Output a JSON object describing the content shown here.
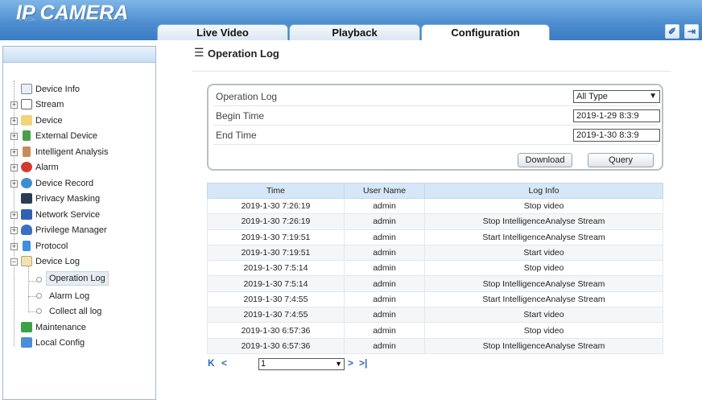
{
  "app": {
    "logo": "IP CAMERA"
  },
  "tabs": [
    {
      "label": "Live Video"
    },
    {
      "label": "Playback"
    },
    {
      "label": "Configuration",
      "active": true
    }
  ],
  "header_icons": [
    {
      "icon": "edit-icon"
    },
    {
      "icon": "logout-icon"
    }
  ],
  "sidebar": {
    "items": [
      {
        "label": "Device Info",
        "icon": "device-info-icon"
      },
      {
        "label": "Stream",
        "icon": "stream-icon"
      },
      {
        "label": "Device",
        "icon": "device-icon"
      },
      {
        "label": "External Device",
        "icon": "external-device-icon"
      },
      {
        "label": "Intelligent Analysis",
        "icon": "intelligent-analysis-icon"
      },
      {
        "label": "Alarm",
        "icon": "alarm-icon"
      },
      {
        "label": "Device Record",
        "icon": "device-record-icon"
      },
      {
        "label": "Privacy Masking",
        "icon": "privacy-masking-icon"
      },
      {
        "label": "Network Service",
        "icon": "network-service-icon"
      },
      {
        "label": "Privilege Manager",
        "icon": "privilege-manager-icon"
      },
      {
        "label": "Protocol",
        "icon": "protocol-icon"
      },
      {
        "label": "Device Log",
        "icon": "device-log-icon"
      },
      {
        "label": "Operation Log",
        "selected": true
      },
      {
        "label": "Alarm Log"
      },
      {
        "label": "Collect all log"
      },
      {
        "label": "Maintenance",
        "icon": "maintenance-icon"
      },
      {
        "label": "Local Config",
        "icon": "local-config-icon"
      }
    ]
  },
  "page": {
    "title": "Operation Log"
  },
  "query": {
    "operation_log_label": "Operation Log",
    "type_value": "All Type",
    "begin_label": "Begin Time",
    "begin_value": "2019-1-29 8:3:9",
    "end_label": "End Time",
    "end_value": "2019-1-30 8:3:9",
    "download_label": "Download",
    "query_label": "Query"
  },
  "table": {
    "columns": [
      "Time",
      "User Name",
      "Log Info"
    ],
    "rows": [
      [
        "2019-1-30 7:26:19",
        "admin",
        "Stop video"
      ],
      [
        "2019-1-30 7:26:19",
        "admin",
        "Stop IntelligenceAnalyse Stream"
      ],
      [
        "2019-1-30 7:19:51",
        "admin",
        "Start IntelligenceAnalyse Stream"
      ],
      [
        "2019-1-30 7:19:51",
        "admin",
        "Start video"
      ],
      [
        "2019-1-30 7:5:14",
        "admin",
        "Stop video"
      ],
      [
        "2019-1-30 7:5:14",
        "admin",
        "Stop IntelligenceAnalyse Stream"
      ],
      [
        "2019-1-30 7:4:55",
        "admin",
        "Start IntelligenceAnalyse Stream"
      ],
      [
        "2019-1-30 7:4:55",
        "admin",
        "Start video"
      ],
      [
        "2019-1-30 6:57:36",
        "admin",
        "Stop video"
      ],
      [
        "2019-1-30 6:57:36",
        "admin",
        "Stop IntelligenceAnalyse Stream"
      ]
    ]
  },
  "pager": {
    "first": "K",
    "prev": "<",
    "page_value": "1",
    "next": ">",
    "last": ">|"
  }
}
